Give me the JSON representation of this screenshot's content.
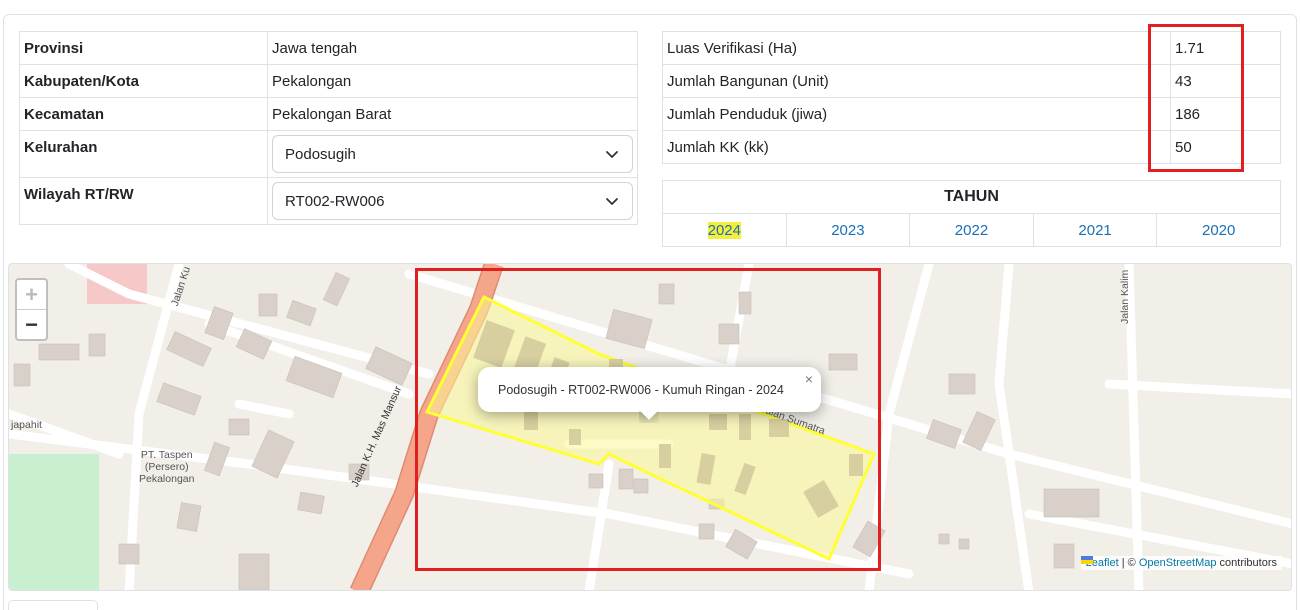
{
  "location": {
    "rows": [
      {
        "key": "Provinsi",
        "value": "Jawa tengah"
      },
      {
        "key": "Kabupaten/Kota",
        "value": "Pekalongan"
      },
      {
        "key": "Kecamatan",
        "value": "Pekalongan Barat"
      }
    ],
    "kelurahan_label": "Kelurahan",
    "kelurahan_selected": "Podosugih",
    "rtrw_label": "Wilayah RT/RW",
    "rtrw_selected": "RT002-RW006"
  },
  "stats": [
    {
      "label": "Luas Verifikasi (Ha)",
      "value": "1.71"
    },
    {
      "label": "Jumlah Bangunan (Unit)",
      "value": "43"
    },
    {
      "label": "Jumlah Penduduk (jiwa)",
      "value": "186"
    },
    {
      "label": "Jumlah KK (kk)",
      "value": "50"
    }
  ],
  "years": {
    "header": "TAHUN",
    "items": [
      "2024",
      "2023",
      "2022",
      "2021",
      "2020"
    ],
    "active": "2024"
  },
  "map": {
    "zoom_in": "+",
    "zoom_out": "−",
    "popup_text": "Podosugih - RT002-RW006 - Kumuh Ringan - 2024",
    "popup_close": "×",
    "attribution": {
      "leaflet": "Leaflet",
      "sep": " | © ",
      "osm": "OpenStreetMap",
      "suffix": " contributors"
    },
    "labels": {
      "jalan_mas_mansur": "Jalan K.H. Mas Mansur",
      "jalan_sumatra": "Jalan Sumatra",
      "jalan_kalim": "Jalan Kalim",
      "jalan_ku": "Jalan Ku",
      "japahit": "japahit",
      "taspen": "PT. Taspen\n(Persero)\nPekalongan"
    }
  },
  "colors": {
    "highlight": "#f5ef3c",
    "red_box": "#e02020",
    "link": "#1a6fb5",
    "polygon_stroke": "#ffff33",
    "main_road": "#f4a58a"
  }
}
